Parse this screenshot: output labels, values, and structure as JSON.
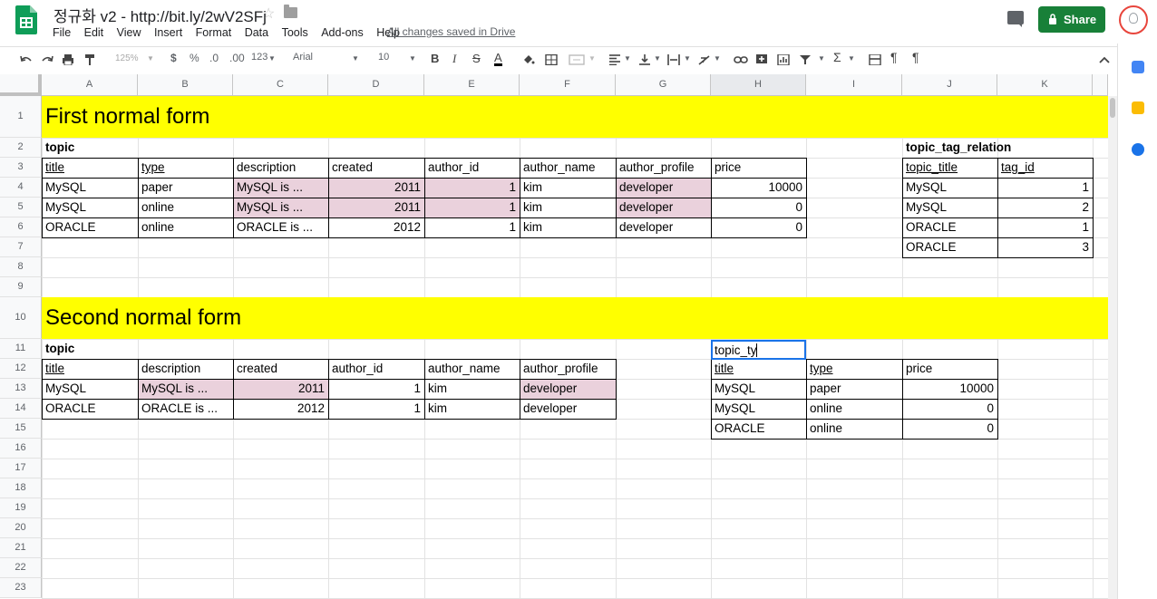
{
  "doc": {
    "title": "정규화 v2  -  http://bit.ly/2wV2SFj"
  },
  "menu": [
    "File",
    "Edit",
    "View",
    "Insert",
    "Format",
    "Data",
    "Tools",
    "Add-ons",
    "Help"
  ],
  "status": "All changes saved in Drive",
  "share_label": "Share",
  "toolbar": {
    "zoom": "125%",
    "currency": "$",
    "percent": "%",
    "dec_less": ".0",
    "dec_more": ".00",
    "format_more": "123",
    "font": "Arial",
    "size": "10"
  },
  "grid": {
    "columns": [
      "A",
      "B",
      "C",
      "D",
      "E",
      "F",
      "G",
      "H",
      "I",
      "J",
      "K"
    ],
    "rows": [
      "1",
      "2",
      "3",
      "4",
      "5",
      "6",
      "7",
      "8",
      "9",
      "10",
      "11",
      "12",
      "13",
      "14",
      "15",
      "16",
      "17",
      "18",
      "19",
      "20",
      "21",
      "22",
      "23"
    ],
    "selected_column": "H"
  },
  "sheet": {
    "title1": "First normal form",
    "topic1_label": "topic",
    "topic1_headers": [
      "title",
      "type",
      "description",
      "created",
      "author_id",
      "author_name",
      "author_profile",
      "price"
    ],
    "topic1_rows": [
      [
        "MySQL",
        "paper",
        "MySQL is ...",
        "2011",
        "1",
        "kim",
        "developer",
        "10000"
      ],
      [
        "MySQL",
        "online",
        "MySQL is ...",
        "2011",
        "1",
        "kim",
        "developer",
        "0"
      ],
      [
        "ORACLE",
        "online",
        "ORACLE is ...",
        "2012",
        "1",
        "kim",
        "developer",
        "0"
      ]
    ],
    "relation_label": "topic_tag_relation",
    "relation_headers": [
      "topic_title",
      "tag_id"
    ],
    "relation_rows": [
      [
        "MySQL",
        "1"
      ],
      [
        "MySQL",
        "2"
      ],
      [
        "ORACLE",
        "1"
      ],
      [
        "ORACLE",
        "3"
      ]
    ],
    "title2": "Second normal form",
    "topic2_label": "topic",
    "topic2_headers": [
      "title",
      "description",
      "created",
      "author_id",
      "author_name",
      "author_profile"
    ],
    "topic2_rows": [
      [
        "MySQL",
        "MySQL is ...",
        "2011",
        "1",
        "kim",
        "developer"
      ],
      [
        "ORACLE",
        "ORACLE is ...",
        "2012",
        "1",
        "kim",
        "developer"
      ]
    ],
    "editing_cell_value": "topic_ty",
    "type_headers": [
      "title",
      "type",
      "price"
    ],
    "type_rows": [
      [
        "MySQL",
        "paper",
        "10000"
      ],
      [
        "MySQL",
        "online",
        "0"
      ],
      [
        "ORACLE",
        "online",
        "0"
      ]
    ]
  },
  "colors": {
    "highlight_yellow": "#ffff00",
    "pink": "#ead1dc",
    "share_green": "#188038",
    "selection_blue": "#1a73e8"
  },
  "icons": [
    "sheets-logo-icon",
    "star-icon",
    "folder-icon",
    "comment-icon",
    "share-icon",
    "assistant-bulb-icon",
    "calendar-icon",
    "keep-icon",
    "tasks-icon"
  ]
}
